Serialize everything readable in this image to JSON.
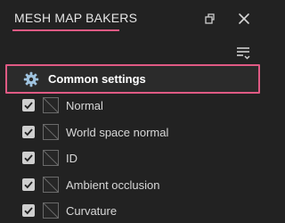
{
  "panel": {
    "title": "MESH MAP BAKERS",
    "accent_color": "#e05a84"
  },
  "icons": {
    "restore": "restore-window-icon",
    "close": "close-icon",
    "options": "list-options-icon",
    "gear": "gear-icon"
  },
  "common": {
    "label": "Common settings"
  },
  "bakers": [
    {
      "label": "Normal",
      "checked": true
    },
    {
      "label": "World space normal",
      "checked": true
    },
    {
      "label": "ID",
      "checked": true
    },
    {
      "label": "Ambient occlusion",
      "checked": true
    },
    {
      "label": "Curvature",
      "checked": true
    }
  ]
}
